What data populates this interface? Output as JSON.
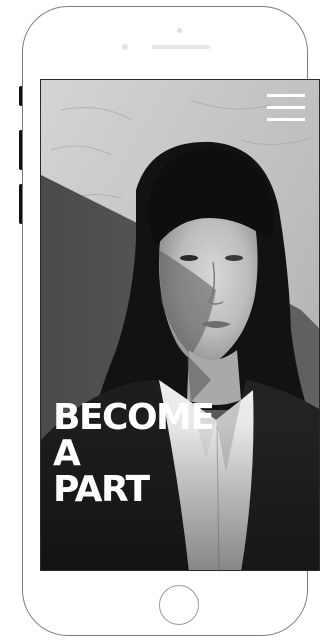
{
  "hero": {
    "headline_lines": [
      "BECOME",
      "A",
      "PART"
    ]
  },
  "icons": {
    "menu": "hamburger-menu-icon",
    "home": "home-button-icon"
  },
  "colors": {
    "headline_text": "#ffffff",
    "menu_icon": "#ffffff",
    "photo_tone": "grayscale"
  }
}
